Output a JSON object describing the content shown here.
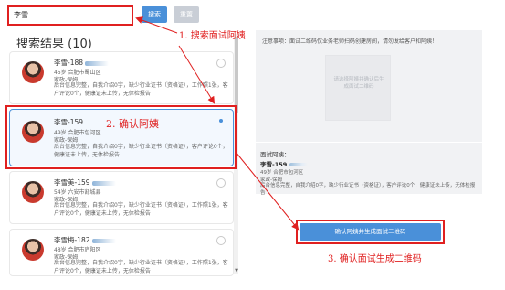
{
  "search": {
    "value": "李雪",
    "search_button": "搜索",
    "reset_button": "重置"
  },
  "results": {
    "title": "搜索结果 (10)",
    "items": [
      {
        "name": "李雪-188",
        "age_location": "45岁 合肥市蜀山区",
        "type": "家政-保姆",
        "desc": "后台信息完整，自我介绍0字，缺少行业证书（资格证），工作照1张，客户评论0个，健康证未上传，无体检报告",
        "selected": false
      },
      {
        "name": "李雪-159",
        "age_location": "49岁 合肥市包河区",
        "type": "家政-保姆",
        "desc": "后台信息完整，自我介绍0字，缺少行业证书（资格证），客户评论0个，健康证未上传，无体检报告",
        "selected": true
      },
      {
        "name": "李雪美-159",
        "age_location": "54岁 六安市舒城县",
        "type": "家政-保姆",
        "desc": "后台信息完整，自我介绍0字，缺少行业证书（资格证），工作照1张，客户评论0个，健康证未上传，无体检报告",
        "selected": false
      },
      {
        "name": "李雪梅-182",
        "age_location": "48岁 合肥市庐阳区",
        "type": "家政-保姆",
        "desc": "后台信息完整，自我介绍0字，缺少行业证书（资格证），工作照1张，客户评论0个，健康证未上传，无体检报告",
        "selected": false
      }
    ]
  },
  "notice": {
    "label": "注意事项：面试二维码仅业务老师扫码创建房间，请勿发给客户和阿姨！",
    "qr_placeholder": "请选择阿姨并确认后生成面试二维码"
  },
  "auntie": {
    "heading": "面试阿姨：",
    "name": "李雪-159",
    "age_location": "49岁 合肥市包河区",
    "type": "家政-保姆",
    "desc": "后台信息完整，自我介绍0字，缺少行业证书（资格证），客户评论0个，健康证未上传，无体检报告"
  },
  "confirm_button": "确认阿姨并生成面试二维码",
  "annotations": {
    "step1": "1. 搜索面试阿姨",
    "step2": "2. 确认阿姨",
    "step3": "3. 确认面试生成二维码"
  },
  "colors": {
    "primary": "#4a90d9",
    "annotation": "#e02020",
    "panel_bg": "#f1f2f4"
  }
}
